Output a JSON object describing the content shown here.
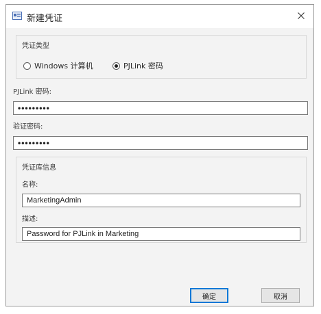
{
  "dialog": {
    "title": "新建凭证"
  },
  "credential_type": {
    "group_label": "凭证类型",
    "options": [
      {
        "label": "Windows 计算机",
        "checked": false
      },
      {
        "label": "PJLink 密码",
        "checked": true
      }
    ]
  },
  "pjlink_password": {
    "label": "PJLink 密码:",
    "value": "•••••••••"
  },
  "confirm_password": {
    "label": "验证密码:",
    "value": "•••••••••"
  },
  "credential_info": {
    "group_label": "凭证库信息",
    "name_label": "名称:",
    "name_value": "MarketingAdmin",
    "description_label": "描述:",
    "description_value": "Password for PJLink in Marketing"
  },
  "buttons": {
    "ok_label": "确定",
    "cancel_label": "取消"
  },
  "colors": {
    "accent": "#0078d7",
    "window_bg": "#f3f3f3"
  }
}
